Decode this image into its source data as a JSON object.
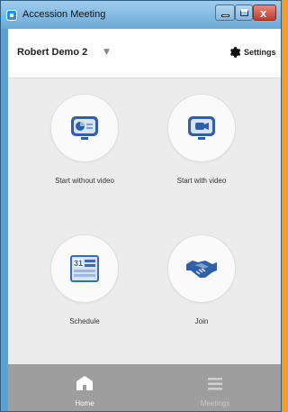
{
  "window": {
    "title": "Accession Meeting"
  },
  "header": {
    "user_name": "Robert Demo 2",
    "dropdown_icon": "chevron-down-icon",
    "settings_label": "Settings",
    "settings_icon": "gear-icon"
  },
  "actions": [
    {
      "label": "Start without video",
      "icon": "screen-share-icon"
    },
    {
      "label": "Start with video",
      "icon": "video-camera-icon"
    },
    {
      "label": "Schedule",
      "icon": "calendar-icon",
      "calendar_day": "31"
    },
    {
      "label": "Join",
      "icon": "handshake-icon"
    }
  ],
  "bottom_nav": {
    "home_label": "Home",
    "meetings_label": "Meetings",
    "active": "Home"
  },
  "colors": {
    "accent": "#3a6bb7",
    "bottom_bar": "#9e9e9e",
    "background": "#ececec"
  }
}
